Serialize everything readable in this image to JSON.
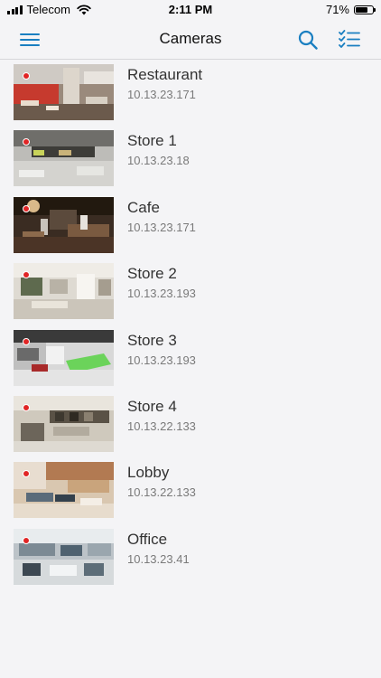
{
  "status_bar": {
    "carrier": "Telecom",
    "time": "2:11 PM",
    "battery": "71%",
    "battery_level": 0.71
  },
  "nav": {
    "title": "Cameras",
    "menu_icon": "hamburger-menu-icon",
    "search_icon": "search-icon",
    "select_icon": "checklist-icon",
    "accent_color": "#1a7fc1"
  },
  "cameras": [
    {
      "name": "Restaurant",
      "ip": "10.13.23.171",
      "recording": true
    },
    {
      "name": "Store 1",
      "ip": "10.13.23.18",
      "recording": true
    },
    {
      "name": "Cafe",
      "ip": "10.13.23.171",
      "recording": true
    },
    {
      "name": "Store 2",
      "ip": "10.13.23.193",
      "recording": true
    },
    {
      "name": "Store 3",
      "ip": "10.13.23.193",
      "recording": true
    },
    {
      "name": "Store 4",
      "ip": "10.13.22.133",
      "recording": true
    },
    {
      "name": "Lobby",
      "ip": "10.13.22.133",
      "recording": true
    },
    {
      "name": "Office",
      "ip": "10.13.23.41",
      "recording": true
    }
  ],
  "colors": {
    "recording_dot": "#e02525"
  }
}
